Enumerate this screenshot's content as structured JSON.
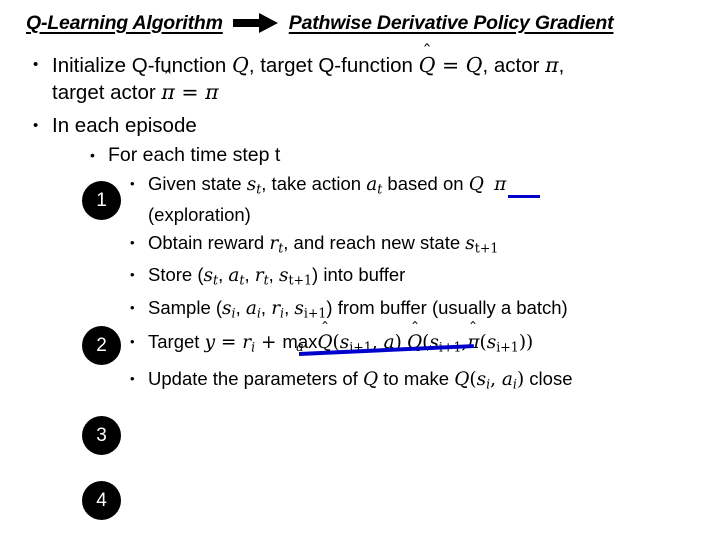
{
  "title": {
    "left": "Q-Learning Algorithm",
    "arrow_icon": "right-arrow-icon",
    "right": "Pathwise Derivative Policy Gradient"
  },
  "bullets": {
    "b1_pre": "Initialize Q-function ",
    "b1_q": "Q",
    "b1_mid": ", target Q-function ",
    "b1_qhat": "Q",
    "b1_eq": " = ",
    "b1_q2": "Q",
    "b1_actor": ", actor ",
    "b1_pi": "π",
    "b1_comma": ",",
    "b1_line2_pre": "target actor ",
    "b1_line2_pihat": "π",
    "b1_line2_eq": " = ",
    "b1_line2_pi": "π",
    "b2": "In each episode",
    "b3": "For each time step t",
    "s1_pre": "Given state ",
    "s1_s": "s",
    "s1_s_sub": "t",
    "s1_mid": ", take action ",
    "s1_a": "a",
    "s1_a_sub": "t",
    "s1_post": " based on ",
    "s1_struck_q": "Q",
    "s1_new_pi": "π",
    "s1_line2": "(exploration)",
    "s2_pre": "Obtain reward ",
    "s2_r": "r",
    "s2_r_sub": "t",
    "s2_mid": ", and reach new state ",
    "s2_s": "s",
    "s2_s_sub": "t+1",
    "s3_pre": "Store (",
    "s3_s": "s",
    "s3_s_sub": "t",
    "s3_c1": ", ",
    "s3_a": "a",
    "s3_a_sub": "t",
    "s3_c2": ", ",
    "s3_r": "r",
    "s3_r_sub": "t",
    "s3_c3": ", ",
    "s3_s2": "s",
    "s3_s2_sub": "t+1",
    "s3_post": ") into buffer",
    "s4_pre": "Sample (",
    "s4_s": "s",
    "s4_s_sub": "i",
    "s4_c1": ", ",
    "s4_a": "a",
    "s4_a_sub": "i",
    "s4_c2": ", ",
    "s4_r": "r",
    "s4_r_sub": "i",
    "s4_c3": ", ",
    "s4_s2": "s",
    "s4_s2_sub": "i+1",
    "s4_post": ") from buffer (usually a batch)",
    "s5_pre": "Target ",
    "s5_y": "y",
    "s5_eq": " = ",
    "s5_r": "r",
    "s5_r_sub": "i",
    "s5_plus": " + ",
    "s5_max": "max",
    "s5_max_sub": "a",
    "s5_old_q": "Q",
    "s5_old_args_open": "(",
    "s5_old_s": "s",
    "s5_old_s_sub": "i+1",
    "s5_old_comma": ", ",
    "s5_old_a": "a",
    "s5_old_args_close": ")",
    "s5_new_q": "Q",
    "s5_new_open": "(",
    "s5_new_s": "s",
    "s5_new_s_sub": "i+1",
    "s5_new_comma": ",",
    "s5_new_pihat": "π",
    "s5_new_open2": "(",
    "s5_new_s2": "s",
    "s5_new_s2_sub": "i+1",
    "s5_new_close2": ")",
    "s5_new_close": ")",
    "s6_pre": "Update the parameters of ",
    "s6_q": "Q",
    "s6_mid": " to make ",
    "s6_q2": "Q",
    "s6_open": "(",
    "s6_s": "s",
    "s6_s_sub": "i",
    "s6_comma": ", ",
    "s6_a": "a",
    "s6_a_sub": "i",
    "s6_close": ")",
    "s6_post": " close"
  },
  "steps": [
    {
      "label": "1"
    },
    {
      "label": "2"
    },
    {
      "label": "3"
    },
    {
      "label": "4"
    }
  ],
  "colors": {
    "strike_blue": "#0000CC",
    "text": "#000000",
    "background": "#FFFFFF",
    "circle_fill": "#000000",
    "circle_text": "#FFFFFF"
  },
  "hat_glyph": "ˆ"
}
